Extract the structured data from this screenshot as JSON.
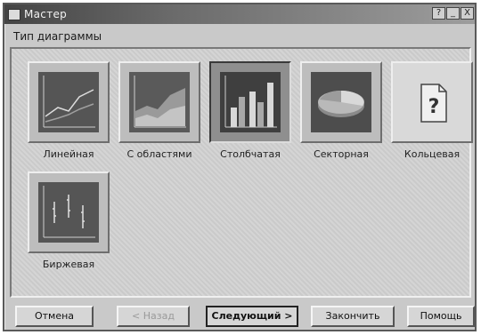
{
  "window": {
    "title": "Мастер",
    "controls": [
      "?",
      "_",
      "X"
    ]
  },
  "section_label": "Тип диаграммы",
  "chart_types": [
    {
      "label": "Линейная",
      "icon": "line-chart-icon",
      "selected": false
    },
    {
      "label": "С областями",
      "icon": "area-chart-icon",
      "selected": false
    },
    {
      "label": "Столбчатая",
      "icon": "bar-chart-icon",
      "selected": true
    },
    {
      "label": "Секторная",
      "icon": "pie-chart-icon",
      "selected": false
    },
    {
      "label": "Кольцевая",
      "icon": "unknown-chart-icon",
      "selected": false
    },
    {
      "label": "Биржевая",
      "icon": "stock-chart-icon",
      "selected": false
    }
  ],
  "buttons": {
    "cancel": "Отмена",
    "back": "< Назад",
    "next": "Следующий >",
    "finish": "Закончить",
    "help": "Помощь"
  }
}
